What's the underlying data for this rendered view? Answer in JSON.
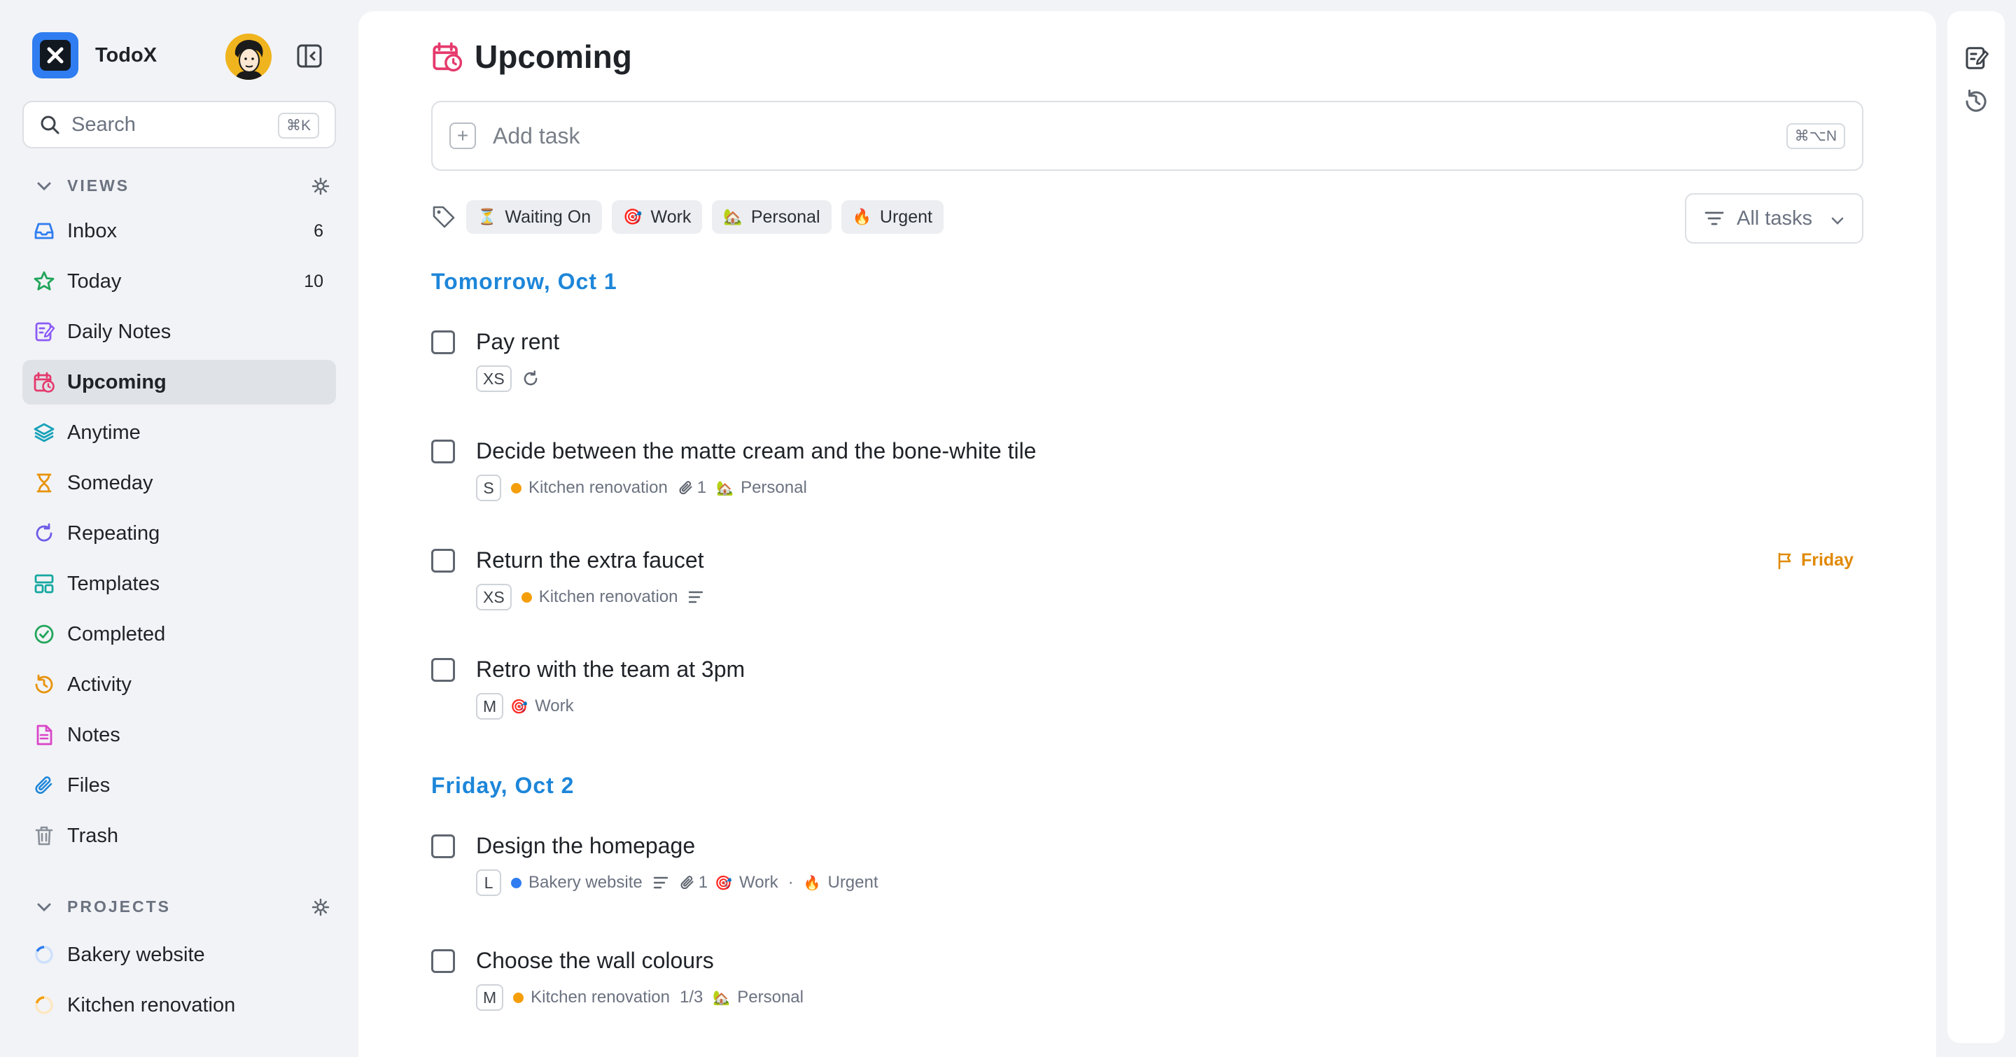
{
  "app": {
    "name": "TodoX"
  },
  "search": {
    "placeholder": "Search",
    "shortcut": "⌘K"
  },
  "sidebar": {
    "views_header": "VIEWS",
    "views": [
      {
        "label": "Inbox",
        "count": "6",
        "icon": "inbox-icon"
      },
      {
        "label": "Today",
        "count": "10",
        "icon": "star-icon"
      },
      {
        "label": "Daily Notes",
        "count": "",
        "icon": "daily-notes-icon"
      },
      {
        "label": "Upcoming",
        "count": "",
        "icon": "calendar-clock-icon",
        "active": true
      },
      {
        "label": "Anytime",
        "count": "",
        "icon": "layers-icon"
      },
      {
        "label": "Someday",
        "count": "",
        "icon": "hourglass-icon"
      },
      {
        "label": "Repeating",
        "count": "",
        "icon": "repeat-icon"
      },
      {
        "label": "Templates",
        "count": "",
        "icon": "templates-icon"
      },
      {
        "label": "Completed",
        "count": "",
        "icon": "check-circle-icon"
      },
      {
        "label": "Activity",
        "count": "",
        "icon": "history-icon"
      },
      {
        "label": "Notes",
        "count": "",
        "icon": "note-icon"
      },
      {
        "label": "Files",
        "count": "",
        "icon": "paperclip-icon"
      },
      {
        "label": "Trash",
        "count": "",
        "icon": "trash-icon"
      }
    ],
    "projects_header": "PROJECTS",
    "projects": [
      {
        "label": "Bakery website",
        "progress": 0.1,
        "color": "#2f7df0"
      },
      {
        "label": "Kitchen renovation",
        "progress": 0.15,
        "color": "#f59e0b"
      }
    ]
  },
  "main": {
    "title": "Upcoming",
    "add_task": {
      "placeholder": "Add task",
      "shortcut": "⌘⌥N"
    },
    "tags": [
      {
        "emoji": "⏳",
        "label": "Waiting On"
      },
      {
        "emoji": "🎯",
        "label": "Work"
      },
      {
        "emoji": "🏡",
        "label": "Personal"
      },
      {
        "emoji": "🔥",
        "label": "Urgent"
      }
    ],
    "filter": {
      "label": "All tasks"
    },
    "groups": [
      {
        "heading": "Tomorrow, Oct 1",
        "tasks": [
          {
            "title": "Pay rent",
            "size": "XS"
          },
          {
            "title": "Decide between the matte cream and the bone-white tile",
            "size": "S",
            "project": "Kitchen renovation",
            "attachments": "1",
            "tag_emoji": "🏡",
            "tag": "Personal"
          },
          {
            "title": "Return the extra faucet",
            "size": "XS",
            "project": "Kitchen renovation",
            "deadline": "Friday"
          },
          {
            "title": "Retro with the team at 3pm",
            "size": "M",
            "tag_emoji": "🎯",
            "tag": "Work"
          }
        ]
      },
      {
        "heading": "Friday, Oct 2",
        "tasks": [
          {
            "title": "Design the homepage",
            "size": "L",
            "project": "Bakery website",
            "attachments": "1",
            "tag_emoji": "🎯",
            "tag": "Work",
            "tag2_emoji": "🔥",
            "tag2": "Urgent",
            "separator": "·"
          },
          {
            "title": "Choose the wall colours",
            "size": "M",
            "project": "Kitchen renovation",
            "subtasks": "1/3",
            "tag_emoji": "🏡",
            "tag": "Personal"
          }
        ]
      }
    ]
  },
  "colors": {
    "accent": "#1d86d9",
    "orange": "#f59e0b",
    "blue": "#2f7df0",
    "deadline": "#e08a06"
  }
}
